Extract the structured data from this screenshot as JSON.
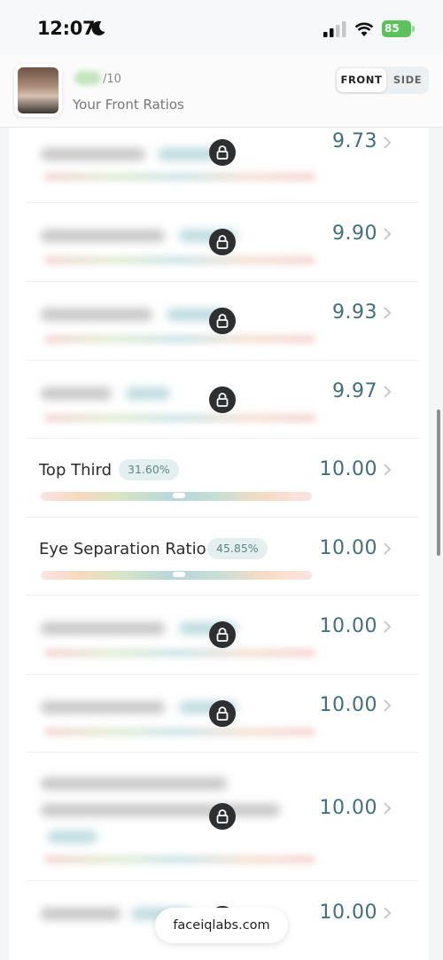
{
  "status": {
    "time": "12:07",
    "battery": "85"
  },
  "header": {
    "score_max": "/10",
    "title": "Your Front Ratios",
    "tabs": {
      "front": "FRONT",
      "side": "SIDE"
    }
  },
  "rows": [
    {
      "value": "9.73",
      "locked": true
    },
    {
      "value": "9.90",
      "locked": true
    },
    {
      "value": "9.93",
      "locked": true
    },
    {
      "value": "9.97",
      "locked": true
    },
    {
      "label": "Top Third",
      "percent": "31.60%",
      "value": "10.00",
      "locked": false,
      "marker": 0.51
    },
    {
      "label": "Eye Separation Ratio",
      "percent": "45.85%",
      "value": "10.00",
      "locked": false,
      "marker": 0.51
    },
    {
      "value": "10.00",
      "locked": true
    },
    {
      "value": "10.00",
      "locked": true
    },
    {
      "value": "10.00",
      "locked": true
    },
    {
      "value": "10.00",
      "locked": true
    }
  ],
  "footer": {
    "domain": "faceiqlabs.com"
  },
  "colors": {
    "value_text": "#426f79",
    "lock_bg": "#2d2f31",
    "battery": "#5cc35a"
  }
}
